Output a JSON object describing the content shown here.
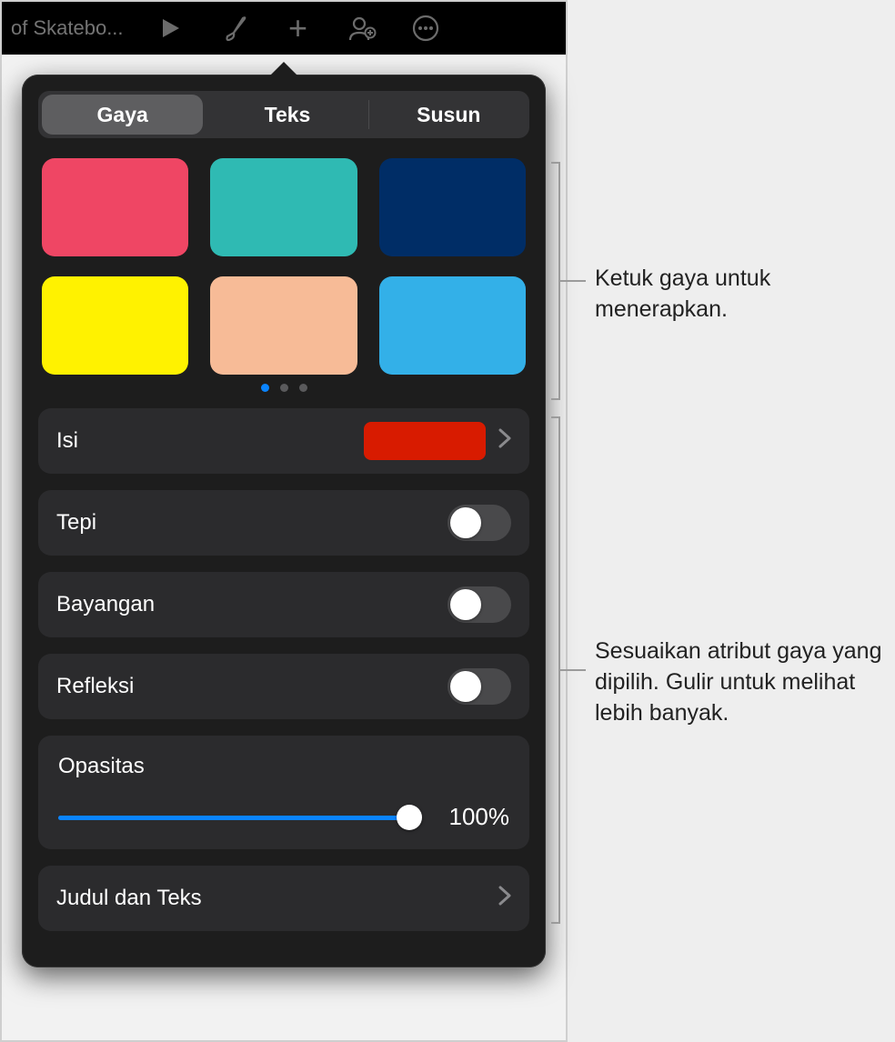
{
  "titlebar": {
    "doc_title": "of Skatebo..."
  },
  "tabs": {
    "items": [
      "Gaya",
      "Teks",
      "Susun"
    ],
    "active_index": 0
  },
  "swatches": {
    "colors": [
      "#ef4664",
      "#2fbab3",
      "#002d66",
      "#fff200",
      "#f7bb97",
      "#33b0e8"
    ]
  },
  "rows": {
    "fill": {
      "label": "Isi",
      "color": "#d81b00"
    },
    "border": {
      "label": "Tepi",
      "on": false
    },
    "shadow": {
      "label": "Bayangan",
      "on": false
    },
    "reflection": {
      "label": "Refleksi",
      "on": false
    },
    "opacity": {
      "label": "Opasitas",
      "value_text": "100%",
      "percent": 100
    },
    "titleText": {
      "label": "Judul dan Teks"
    }
  },
  "callouts": {
    "c1": "Ketuk gaya untuk menerapkan.",
    "c2": "Sesuaikan atribut gaya yang dipilih. Gulir untuk melihat lebih banyak."
  }
}
